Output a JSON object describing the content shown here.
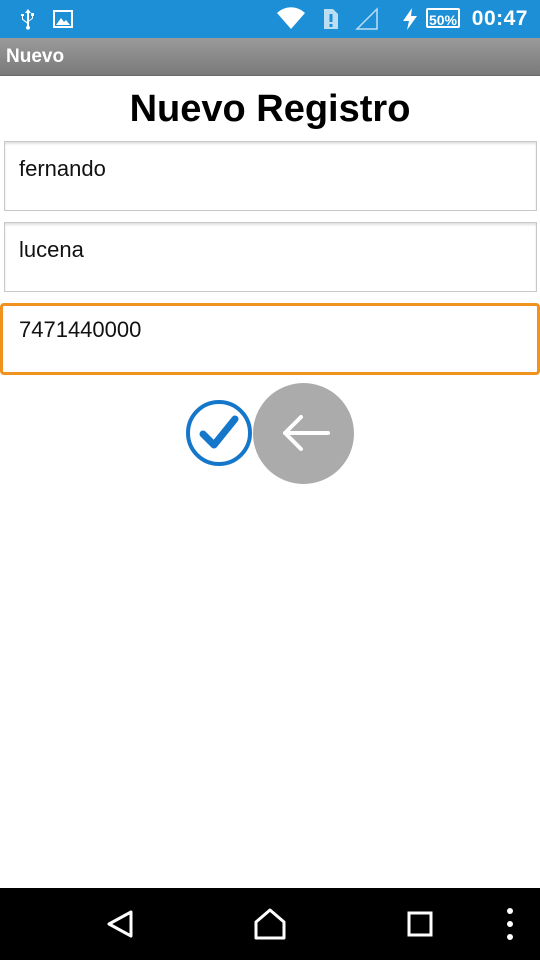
{
  "status_bar": {
    "battery_percent": "50%",
    "time": "00:47",
    "icons": [
      "usb-icon",
      "image-icon",
      "wifi-icon",
      "sim-alert-icon",
      "signal-icon",
      "charging-icon",
      "battery-icon"
    ],
    "background_color": "#1c8fd6"
  },
  "app_bar": {
    "title": "Nuevo"
  },
  "page": {
    "title": "Nuevo Registro"
  },
  "form": {
    "fields": [
      {
        "value": "fernando",
        "focused": false
      },
      {
        "value": "lucena",
        "focused": false
      },
      {
        "value": "7471440000",
        "focused": true
      }
    ],
    "focus_color": "#f0921e"
  },
  "actions": {
    "confirm_icon": "check-circle-icon",
    "back_icon": "arrow-left-icon",
    "confirm_color": "#1577c9"
  },
  "nav_bar": {
    "buttons": [
      "back-triangle-icon",
      "home-icon",
      "recents-icon",
      "overflow-menu-icon"
    ]
  }
}
